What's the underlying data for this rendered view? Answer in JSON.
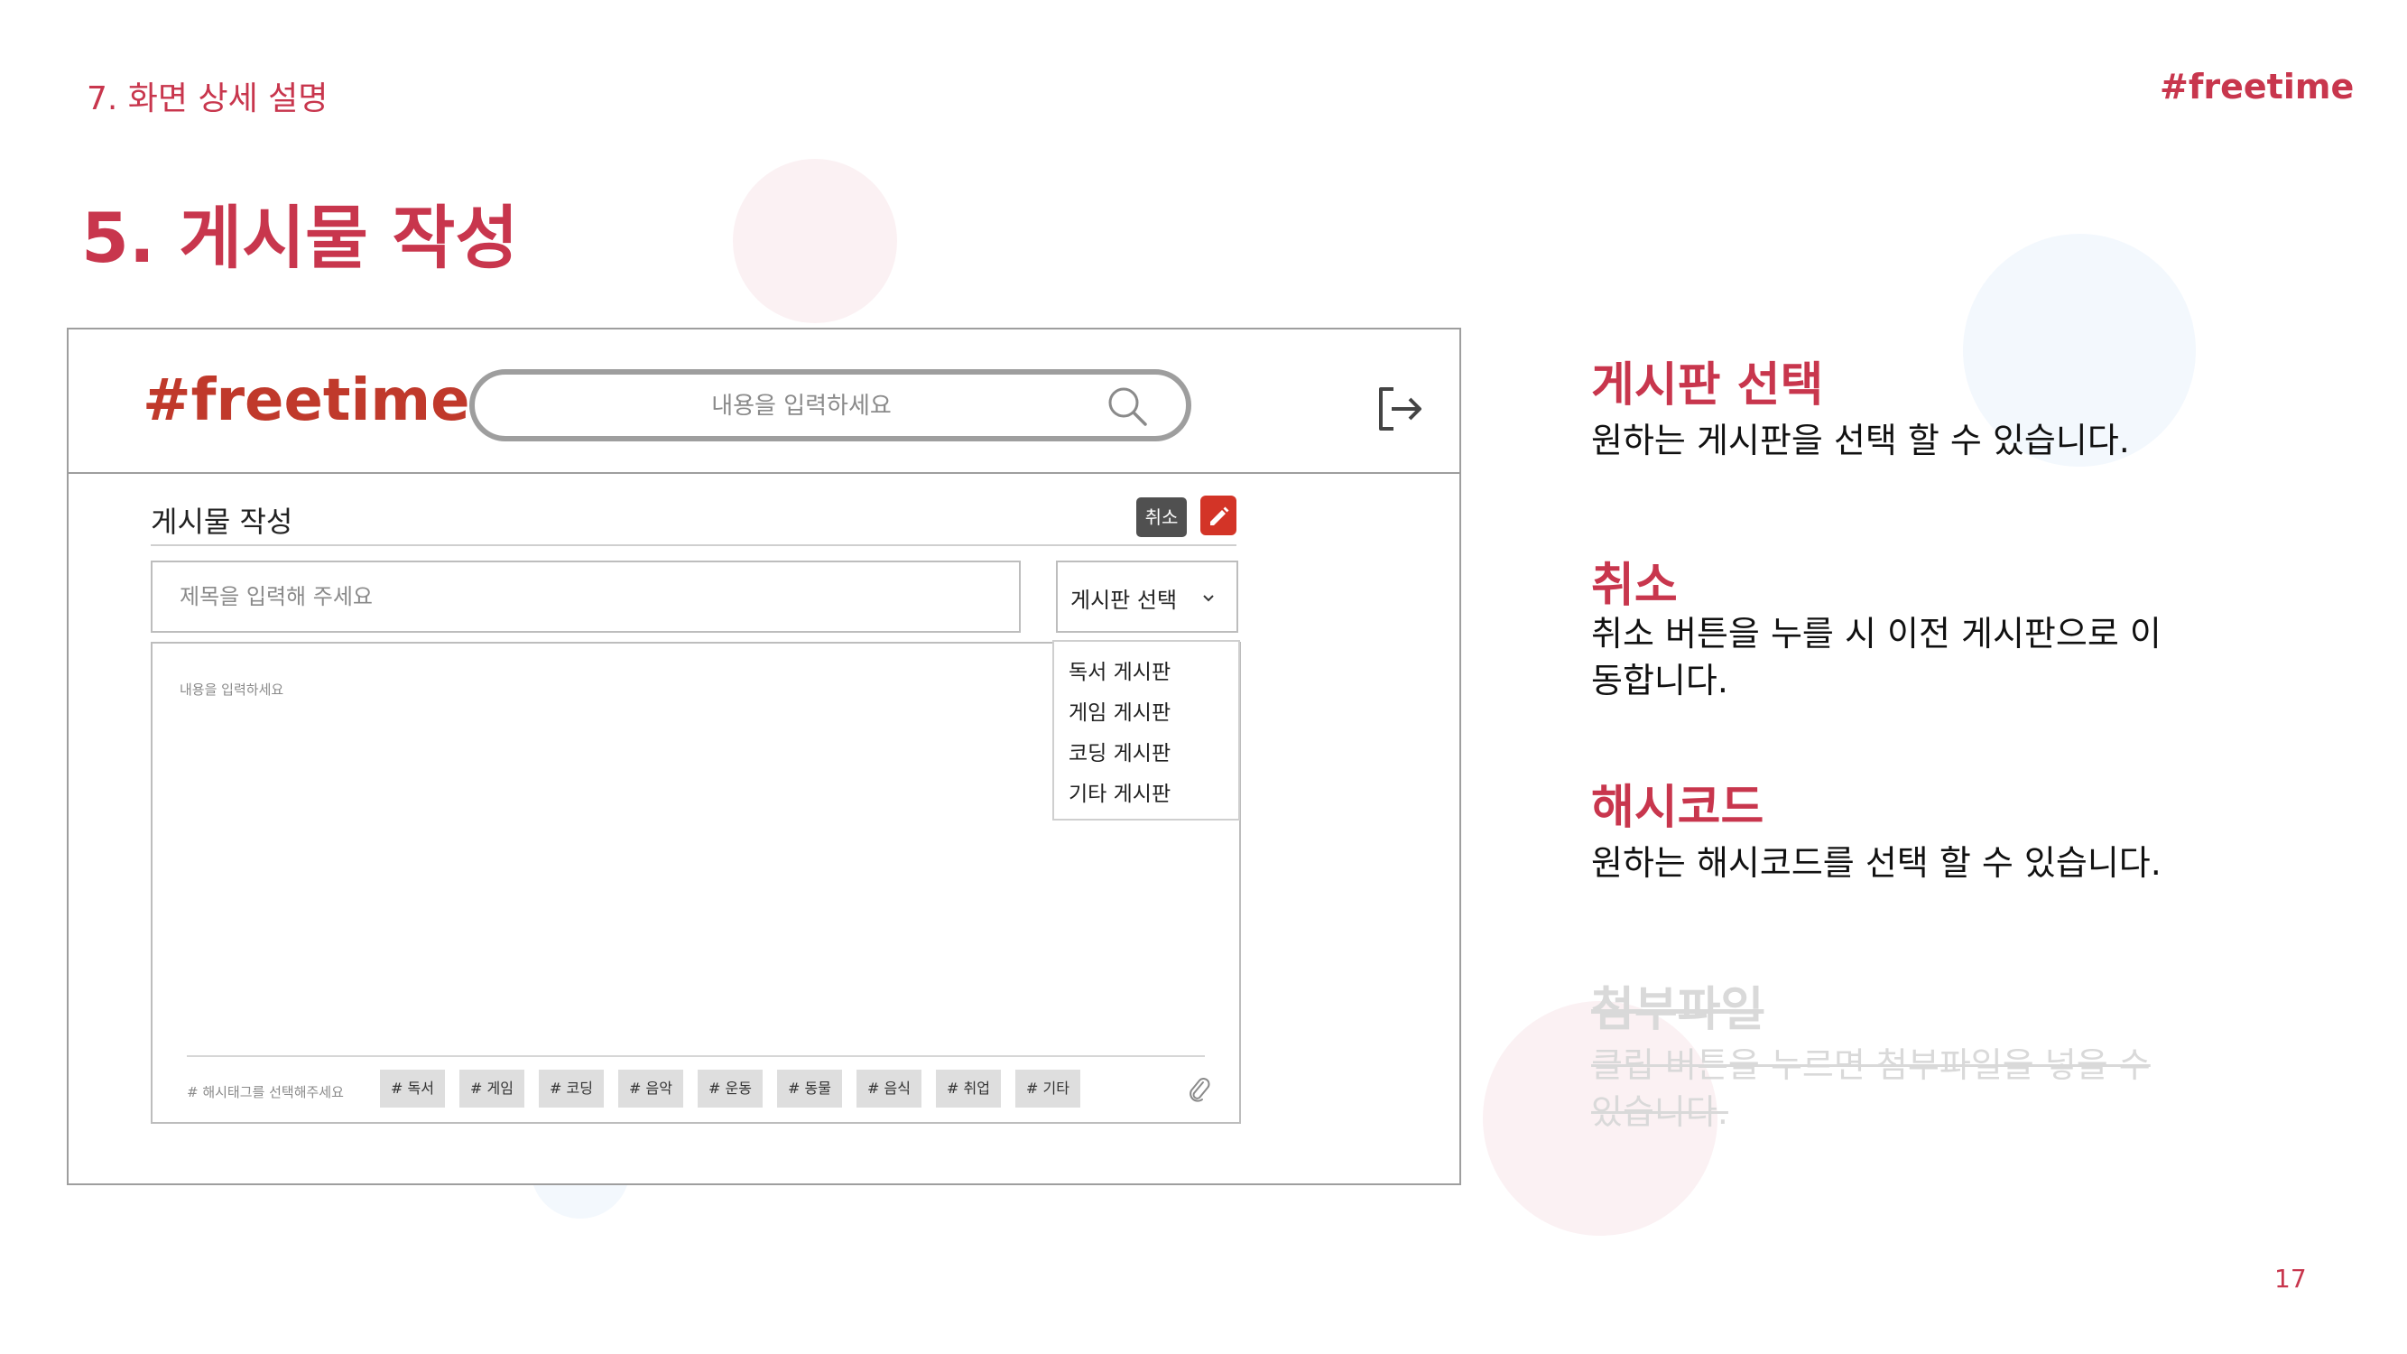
{
  "slide": {
    "section_label": "7. 화면 상세 설명",
    "brand": "#freetime",
    "title": "5. 게시물 작성",
    "page_number": "17"
  },
  "mockup": {
    "logo": "#freetime",
    "search": {
      "placeholder": "내용을 입력하세요",
      "icon": "search-icon"
    },
    "logout_icon": "logout-icon",
    "form": {
      "title": "게시물 작성",
      "cancel_label": "취소",
      "edit_icon": "pencil-icon",
      "title_placeholder": "제목을 입력해 주세요",
      "board_select_label": "게시판 선택",
      "board_options": [
        "독서 게시판",
        "게임 게시판",
        "코딩 게시판",
        "기타 게시판"
      ],
      "content_placeholder": "내용을 입력하세요",
      "hashtag_label": "# 해시태그를 선택해주세요",
      "hashtags": [
        "# 독서",
        "# 게임",
        "# 코딩",
        "# 음악",
        "# 운동",
        "# 동물",
        "# 음식",
        "# 취업",
        "# 기타"
      ],
      "attach_icon": "paperclip-icon"
    }
  },
  "descriptions": [
    {
      "title": "게시판 선택",
      "text": "원하는 게시판을 선택 할 수 있습니다."
    },
    {
      "title": "취소",
      "text": "취소 버튼을 누를 시 이전 게시판으로 이동합니다."
    },
    {
      "title": "해시코드",
      "text": "원하는 해시코드를 선택 할 수 있습니다."
    },
    {
      "title": "첨부파일",
      "text": "클립 버튼을 누르면 첨부파일을 넣을 수 있습니다."
    }
  ],
  "colors": {
    "accent": "#c8364d",
    "logo_red": "#c0392b",
    "border_gray": "#9e9e9e",
    "chip_gray": "#dedede"
  }
}
